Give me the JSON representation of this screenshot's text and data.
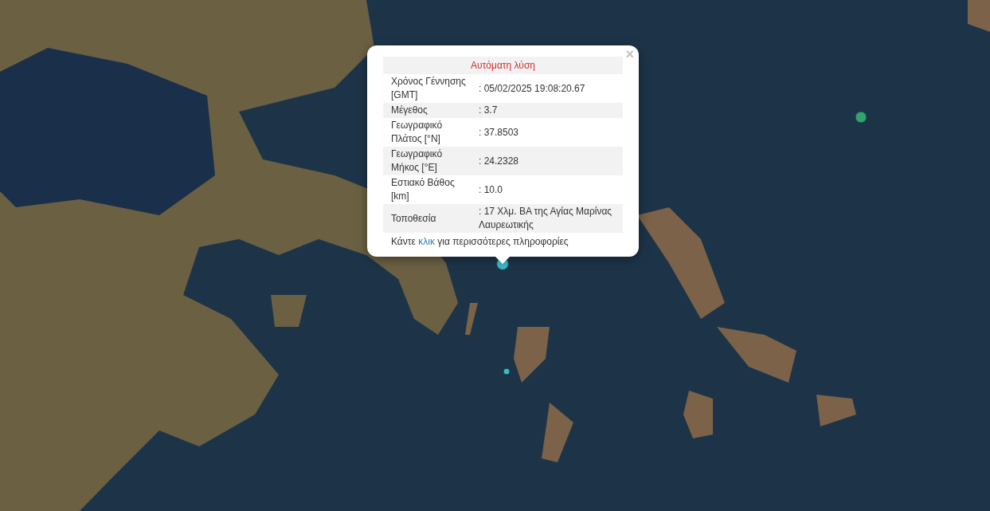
{
  "markers": [
    {
      "kind": "large",
      "color": "#3bb8c9"
    },
    {
      "kind": "medium",
      "color": "#2fa56a"
    },
    {
      "kind": "small",
      "color": "#3bb8c9"
    }
  ],
  "popup": {
    "title": "Αυτόματη λύση",
    "close": "×",
    "rows": [
      {
        "label": "Χρόνος Γέννησης [GMT]",
        "value": ": 05/02/2025 19:08:20.67"
      },
      {
        "label": "Μέγεθος",
        "value": ": 3.7"
      },
      {
        "label": "Γεωγραφικό Πλάτος [°N]",
        "value": ": 37.8503"
      },
      {
        "label": "Γεωγραφικό Μήκος [°E]",
        "value": ": 24.2328"
      },
      {
        "label": "Εστιακό Βάθος [km]",
        "value": ": 10.0"
      },
      {
        "label": "Τοποθεσία",
        "value": ": 17 Χλμ. ΒΑ της Αγίας Μαρίνας Λαυρεωτικής"
      }
    ],
    "footer": {
      "before": "Κάντε",
      "link": "κλικ",
      "after": "για περισσότερες πληροφορίες"
    }
  }
}
